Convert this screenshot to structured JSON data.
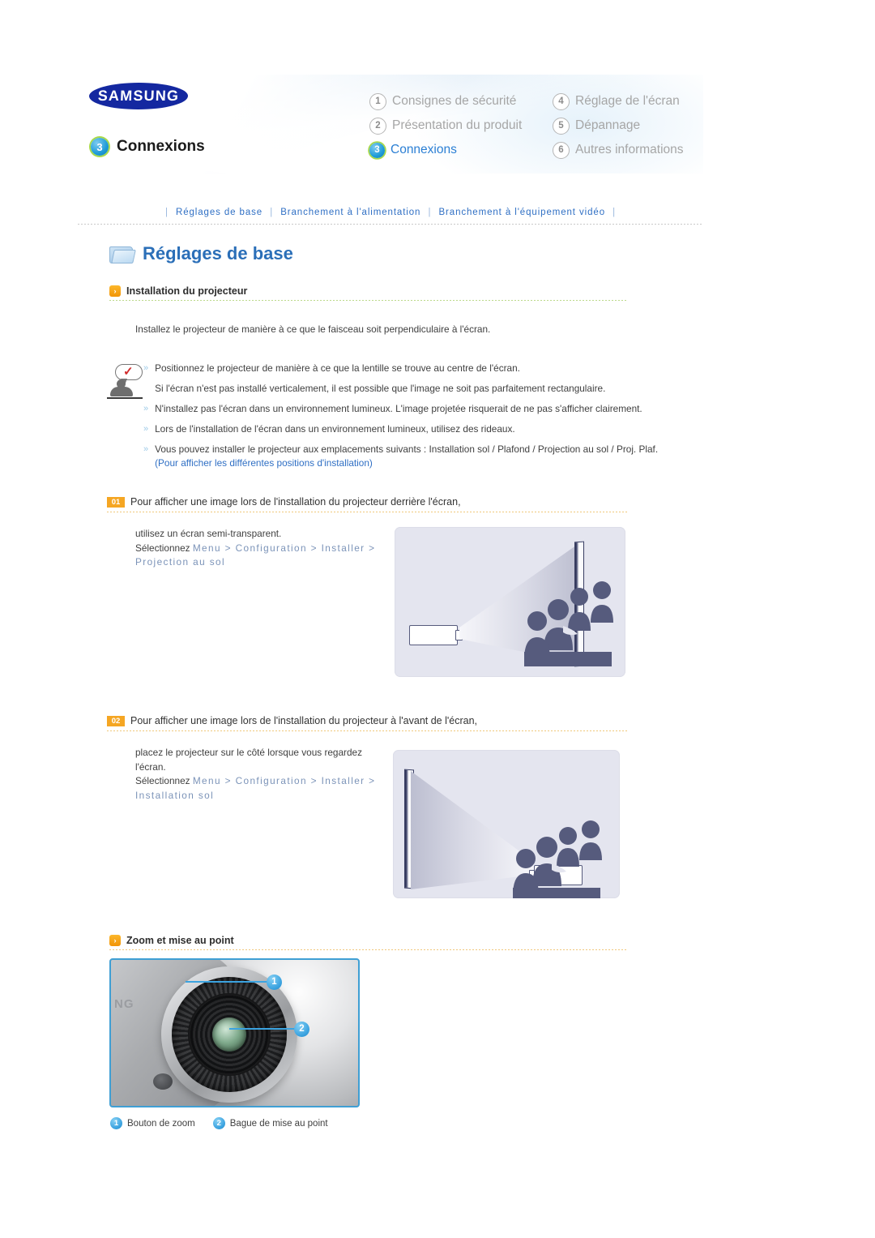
{
  "header": {
    "logo_text": "SAMSUNG",
    "current_section": {
      "number": "3",
      "label": "Connexions"
    },
    "menu": [
      {
        "number": "1",
        "label": "Consignes de sécurité",
        "active": false
      },
      {
        "number": "4",
        "label": "Réglage de l'écran",
        "active": false
      },
      {
        "number": "2",
        "label": "Présentation du produit",
        "active": false
      },
      {
        "number": "5",
        "label": "Dépannage",
        "active": false
      },
      {
        "number": "3",
        "label": "Connexions",
        "active": true
      },
      {
        "number": "6",
        "label": "Autres informations",
        "active": false
      }
    ]
  },
  "topnav": {
    "items": [
      "Réglages de base",
      "Branchement à l'alimentation",
      "Branchement à l'équipement vidéo"
    ],
    "separator": "|"
  },
  "section": {
    "title": "Réglages de base",
    "folder_icon": "folder-icon"
  },
  "subsection1": {
    "badge": "›",
    "title": "Installation du projecteur",
    "intro": "Installez le projecteur de manière à ce que le faisceau soit perpendiculaire à l'écran.",
    "notes": [
      "Positionnez le projecteur de manière à ce que la lentille se trouve au centre de l'écran.",
      "Si l'écran n'est pas installé verticalement, il est possible que l'image ne soit pas parfaitement rectangulaire.",
      "N'installez pas l'écran dans un environnement lumineux. L'image projetée risquerait de ne pas s'afficher clairement.",
      "Lors de l'installation de l'écran dans un environnement lumineux, utilisez des rideaux.",
      "Vous pouvez installer le projecteur aux emplacements suivants : Installation sol / Plafond / Projection au sol / Proj. Plaf."
    ],
    "note_link": "(Pour afficher les différentes positions d'installation)"
  },
  "step1": {
    "badge": "01",
    "title": "Pour afficher une image lors de l'installation du projecteur derrière l'écran,",
    "line1": "utilisez un écran semi-transparent.",
    "line2_prefix": "Sélectionnez ",
    "line2_path": "Menu > Configuration > Installer >",
    "line3_path": "Projection au sol",
    "illustration": "rear-projection-diagram"
  },
  "step2": {
    "badge": "02",
    "title": "Pour afficher une image lors de l'installation du projecteur à l'avant de l'écran,",
    "line1": "placez le projecteur sur le côté lorsque vous regardez",
    "line1b": "l'écran.",
    "line2_prefix": "Sélectionnez ",
    "line2_path": "Menu > Configuration > Installer >",
    "line3_path": "Installation sol",
    "illustration": "front-projection-diagram"
  },
  "subsection2": {
    "badge": "›",
    "title": "Zoom et mise au point",
    "photo_alt": "projector-lens-photo",
    "callouts": [
      {
        "number": "1",
        "label": "Bouton de zoom"
      },
      {
        "number": "2",
        "label": "Bague de mise au point"
      }
    ]
  },
  "colors": {
    "brand_blue": "#1428a0",
    "accent_blue": "#2b7fd4",
    "link_blue": "#2f6fc4",
    "badge_orange": "#f5a623",
    "menu_path_gray_blue": "#7b93b8",
    "callout_blue": "#3ba3e0",
    "illustration_bg": "#e4e5ef",
    "silhouette": "#565b7d"
  }
}
